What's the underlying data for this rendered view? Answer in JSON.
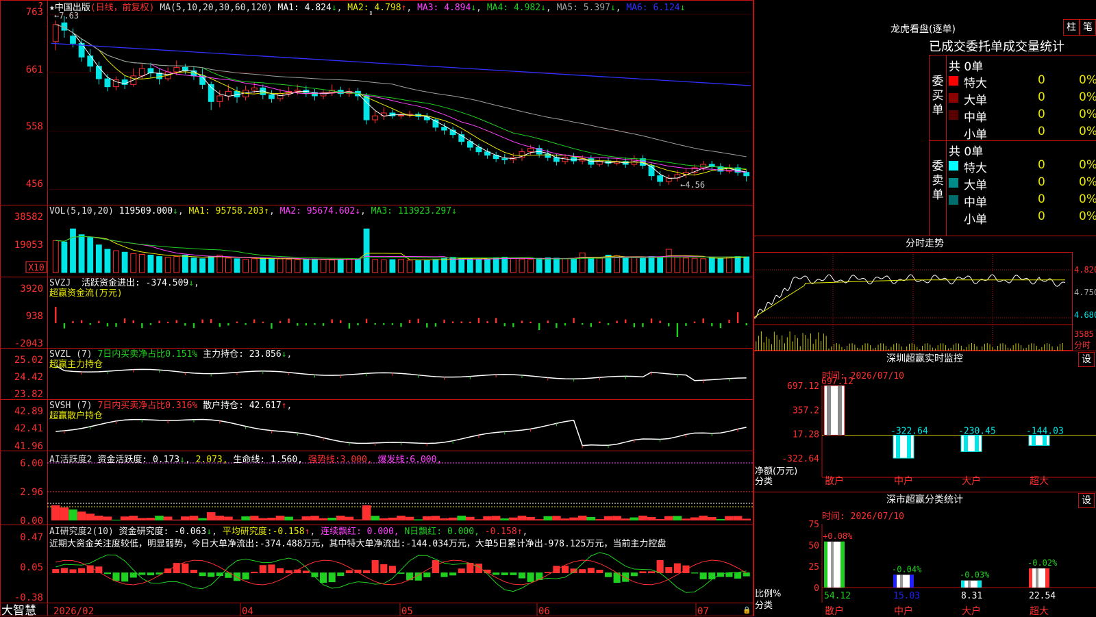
{
  "stock": {
    "star": "★",
    "name": "中国出版",
    "mode": "(日线，前复权)",
    "ma_params": "MA(5,10,20,30,60,120)"
  },
  "colors": {
    "up": "#ff3030",
    "down": "#00e5e5",
    "grid": "#c01010",
    "ma1": "#ffffff",
    "ma2": "#e8e800",
    "ma3": "#ff40ff",
    "ma4": "#20d020",
    "ma5": "#a0a0a0",
    "ma6": "#3030ff"
  },
  "ma_readouts": [
    {
      "label": "MA1:",
      "value": "4.824",
      "arrow": "↓",
      "color": "#ffffff"
    },
    {
      "label": "MA2:",
      "value": "4.798",
      "arrow": "↑",
      "color": "#e8e800"
    },
    {
      "label": "MA3:",
      "value": "4.894",
      "arrow": "↓",
      "color": "#ff40ff"
    },
    {
      "label": "MA4:",
      "value": "4.982",
      "arrow": "↓",
      "color": "#20d020"
    },
    {
      "label": "MA5:",
      "value": "5.397",
      "arrow": "↓",
      "color": "#a0a0a0"
    },
    {
      "label": "MA6:",
      "value": "6.124",
      "arrow": "↓",
      "color": "#3030ff"
    }
  ],
  "price_panel": {
    "y_ticks": [
      "763",
      "661",
      "558",
      "456"
    ],
    "high_marker": "7.63",
    "low_marker": "4.56",
    "corner": "?"
  },
  "vol_panel": {
    "header": "VOL(5,10,20)",
    "value": "119509.000",
    "ma1": "95758.203",
    "ma2": "95674.602",
    "ma3": "113923.297",
    "y_ticks": [
      "38582",
      "19053"
    ],
    "unit": "X10"
  },
  "svzj": {
    "header": "SVZJ",
    "desc": "活跃资金进出:",
    "value": "-374.509",
    "sub": "超赢资金流(万元)",
    "y_ticks": [
      "3920",
      "938",
      "-2043"
    ]
  },
  "svzl": {
    "header": "SVZL (7)",
    "desc": "7日内买卖净占比0.151%",
    "label": "主力持仓:",
    "value": "23.856",
    "sub": "超赢主力持仓",
    "y_ticks": [
      "25.02",
      "24.42",
      "23.82"
    ]
  },
  "svsh": {
    "header": "SVSH (7)",
    "desc": "7日内买卖净占比0.316%",
    "label": "散户持仓:",
    "value": "42.617",
    "sub": "超赢散户持仓",
    "y_ticks": [
      "42.89",
      "42.41",
      "41.96"
    ]
  },
  "ai_active": {
    "header": "AI活跃度2",
    "label1": "资金活跃度:",
    "v1": "0.173",
    "v2": "2.073,",
    "label3": "生命线:",
    "v3": "1.560,",
    "label4": "强势线:",
    "v4": "3.000,",
    "label5": "爆发线:",
    "v5": "6.000,",
    "y_ticks": [
      "6.00",
      "2.96",
      "0.00"
    ]
  },
  "ai_research": {
    "header": "AI研究度2(10)",
    "label1": "资金研究度:",
    "v1": "-0.063",
    "label2": "平均研究度:",
    "v2": "-0.158",
    "label3": "连续飘红:",
    "v3": "0.000,",
    "label4": "N日飘红:",
    "v4": "0.000,",
    "v5": "-0.158",
    "commentary": "近期大资金关注度较低，明显弱势，今日大单净流出:-374.488万元，其中特大单净流出:-144.034万元，大单5日累计净出-978.125万元，当前主力控盘",
    "y_ticks": [
      "0.47",
      "0.05",
      "-0.38"
    ]
  },
  "x_axis": {
    "brand": "大智慧",
    "labels": [
      "2026/02",
      "04",
      "05",
      "06",
      "07"
    ]
  },
  "longhu": {
    "title": "龙虎看盘(逐单)",
    "btn1": "柱",
    "btn2": "笔",
    "subtitle": "已成交委托单成交量统计",
    "buy": {
      "side": "委买单",
      "total": "共 0单",
      "rows": [
        {
          "label": "特大",
          "count": "0",
          "pct": "0%",
          "color": "#ff0000"
        },
        {
          "label": "大单",
          "count": "0",
          "pct": "0%",
          "color": "#8b0000"
        },
        {
          "label": "中单",
          "count": "0",
          "pct": "0%",
          "color": "#5a0000"
        },
        {
          "label": "小单",
          "count": "0",
          "pct": "0%",
          "color": "#000000"
        }
      ]
    },
    "sell": {
      "side": "委卖单",
      "total": "共 0单",
      "rows": [
        {
          "label": "特大",
          "count": "0",
          "pct": "0%",
          "color": "#00ffff"
        },
        {
          "label": "大单",
          "count": "0",
          "pct": "0%",
          "color": "#008b8b"
        },
        {
          "label": "中单",
          "count": "0",
          "pct": "0%",
          "color": "#006d6d"
        },
        {
          "label": "小单",
          "count": "0",
          "pct": "0%",
          "color": "#000000"
        }
      ]
    }
  },
  "intraday": {
    "title": "分时走势",
    "y_ticks": [
      "4.820",
      "4.750",
      "4.680"
    ],
    "vol_tick": "3585",
    "vol_unit": "分时"
  },
  "sz_monitor": {
    "title": "深圳超赢实时监控",
    "btn": "设",
    "time": "时间: 2026/07/10",
    "y_ticks": [
      "697.12",
      "357.2",
      "17.28",
      "-322.64"
    ],
    "ylabel": "净额(万元)",
    "xlabel": "分类"
  },
  "sz_class": {
    "title": "深市超赢分类统计",
    "btn": "设",
    "time": "时间: 2026/07/10",
    "y_ticks": [
      "75",
      "50",
      "25",
      "0"
    ],
    "ylabel": "比例%",
    "xlabel": "分类"
  },
  "chart_data": [
    {
      "type": "candlestick",
      "title": "中国出版 (日线，前复权)",
      "unit": "price scaled ×100",
      "ylim": [
        456,
        763
      ],
      "x_labels": [
        "2026/02",
        "04",
        "05",
        "06",
        "07"
      ],
      "candles": [
        [
          715,
          745,
          752,
          700
        ],
        [
          748,
          735,
          760,
          722
        ],
        [
          725,
          712,
          738,
          705
        ],
        [
          712,
          688,
          720,
          680
        ],
        [
          690,
          672,
          702,
          662
        ],
        [
          672,
          650,
          680,
          640
        ],
        [
          650,
          636,
          658,
          628
        ],
        [
          636,
          648,
          654,
          630
        ],
        [
          648,
          640,
          656,
          632
        ],
        [
          640,
          655,
          668,
          636
        ],
        [
          655,
          668,
          676,
          650
        ],
        [
          668,
          660,
          678,
          652
        ],
        [
          660,
          650,
          668,
          640
        ],
        [
          650,
          662,
          670,
          646
        ],
        [
          662,
          670,
          682,
          656
        ],
        [
          670,
          664,
          676,
          658
        ],
        [
          664,
          655,
          672,
          648
        ],
        [
          655,
          640,
          668,
          632
        ],
        [
          640,
          610,
          645,
          595
        ],
        [
          610,
          620,
          630,
          600
        ],
        [
          620,
          628,
          640,
          612
        ],
        [
          628,
          618,
          636,
          608
        ],
        [
          618,
          630,
          638,
          612
        ],
        [
          630,
          634,
          644,
          624
        ],
        [
          634,
          622,
          640,
          614
        ],
        [
          622,
          615,
          630,
          608
        ],
        [
          615,
          624,
          632,
          610
        ],
        [
          624,
          628,
          636,
          618
        ],
        [
          628,
          630,
          640,
          622
        ],
        [
          630,
          626,
          638,
          618
        ],
        [
          626,
          620,
          632,
          612
        ],
        [
          620,
          625,
          630,
          614
        ],
        [
          625,
          630,
          640,
          620
        ],
        [
          630,
          624,
          636,
          618
        ],
        [
          624,
          628,
          634,
          618
        ],
        [
          628,
          620,
          634,
          612
        ],
        [
          620,
          578,
          625,
          570
        ],
        [
          578,
          585,
          594,
          572
        ],
        [
          585,
          590,
          600,
          578
        ],
        [
          590,
          585,
          596,
          580
        ],
        [
          585,
          586,
          592,
          580
        ],
        [
          586,
          588,
          594,
          582
        ],
        [
          588,
          584,
          592,
          578
        ],
        [
          584,
          578,
          590,
          572
        ],
        [
          578,
          565,
          582,
          558
        ],
        [
          565,
          560,
          572,
          552
        ],
        [
          560,
          552,
          566,
          546
        ],
        [
          552,
          540,
          558,
          534
        ],
        [
          540,
          530,
          546,
          524
        ],
        [
          530,
          522,
          536,
          516
        ],
        [
          522,
          516,
          528,
          510
        ],
        [
          516,
          510,
          522,
          504
        ],
        [
          510,
          508,
          518,
          500
        ],
        [
          508,
          512,
          520,
          502
        ],
        [
          512,
          522,
          528,
          506
        ],
        [
          522,
          528,
          534,
          516
        ],
        [
          528,
          518,
          534,
          512
        ],
        [
          518,
          512,
          526,
          506
        ],
        [
          512,
          505,
          518,
          498
        ],
        [
          505,
          512,
          518,
          500
        ],
        [
          512,
          506,
          520,
          500
        ],
        [
          506,
          510,
          516,
          500
        ],
        [
          510,
          500,
          516,
          494
        ],
        [
          500,
          506,
          512,
          496
        ],
        [
          506,
          502,
          512,
          496
        ],
        [
          502,
          505,
          510,
          498
        ],
        [
          505,
          500,
          512,
          494
        ],
        [
          500,
          510,
          516,
          496
        ],
        [
          510,
          498,
          516,
          492
        ],
        [
          498,
          480,
          502,
          472
        ],
        [
          480,
          470,
          488,
          462
        ],
        [
          470,
          476,
          482,
          464
        ],
        [
          476,
          482,
          490,
          470
        ],
        [
          482,
          486,
          494,
          476
        ],
        [
          486,
          494,
          500,
          480
        ],
        [
          494,
          500,
          506,
          488
        ],
        [
          500,
          496,
          506,
          488
        ],
        [
          496,
          488,
          502,
          482
        ],
        [
          488,
          494,
          500,
          484
        ],
        [
          494,
          486,
          500,
          480
        ],
        [
          486,
          480,
          490,
          470
        ]
      ],
      "series": [
        {
          "name": "MA1",
          "value": "4.824"
        },
        {
          "name": "MA2",
          "value": "4.798"
        },
        {
          "name": "MA3",
          "value": "4.894"
        },
        {
          "name": "MA4",
          "value": "4.982"
        },
        {
          "name": "MA5",
          "value": "5.397"
        },
        {
          "name": "MA6",
          "value": "6.124"
        }
      ],
      "high": 7.63,
      "low": 4.56
    },
    {
      "type": "bar",
      "title": "VOL(5,10,20)",
      "unit": "X10",
      "ylim": [
        0,
        38582
      ],
      "values": [
        22000,
        21000,
        30000,
        26000,
        24000,
        19000,
        16000,
        15000,
        14000,
        13000,
        12500,
        12000,
        11000,
        10500,
        11000,
        12000,
        10000,
        9500,
        11000,
        12000,
        10000,
        9500,
        9000,
        9500,
        10000,
        9800,
        9400,
        9100,
        8800,
        9000,
        9200,
        8800,
        8600,
        9000,
        9500,
        9100,
        30000,
        9000,
        8700,
        8900,
        9100,
        8500,
        8200,
        8600,
        9000,
        10000,
        10500,
        9800,
        9400,
        9200,
        9000,
        10200,
        10600,
        9600,
        9300,
        9000,
        9800,
        10100,
        9900,
        9500,
        9700,
        13500,
        10000,
        9800,
        12000,
        11500,
        10800,
        10200,
        9900,
        11000,
        10500,
        16000,
        10500,
        10000,
        9800,
        9500,
        10200,
        9900,
        10500,
        11000,
        10800
      ]
    },
    {
      "type": "bar",
      "title": "SVZJ 活跃资金进出",
      "ylim": [
        -2043,
        3920
      ],
      "values_note": "daily capital flow (万元), last -374.509"
    },
    {
      "type": "bar",
      "title": "深圳超赢实时监控",
      "ylabel": "净额(万元)",
      "categories": [
        "散户",
        "中户",
        "大户",
        "超大"
      ],
      "values": [
        697.12,
        -322.64,
        -230.45,
        -144.03
      ],
      "ylim": [
        -322.64,
        697.12
      ]
    },
    {
      "type": "bar",
      "title": "深市超赢分类统计",
      "ylabel": "比例%",
      "categories": [
        "散户",
        "中户",
        "大户",
        "超大"
      ],
      "values": [
        54.12,
        15.03,
        8.31,
        22.54
      ],
      "changes": [
        "+0.08%",
        "-0.04%",
        "-0.03%",
        "-0.02%"
      ],
      "ylim": [
        0,
        75
      ]
    }
  ]
}
